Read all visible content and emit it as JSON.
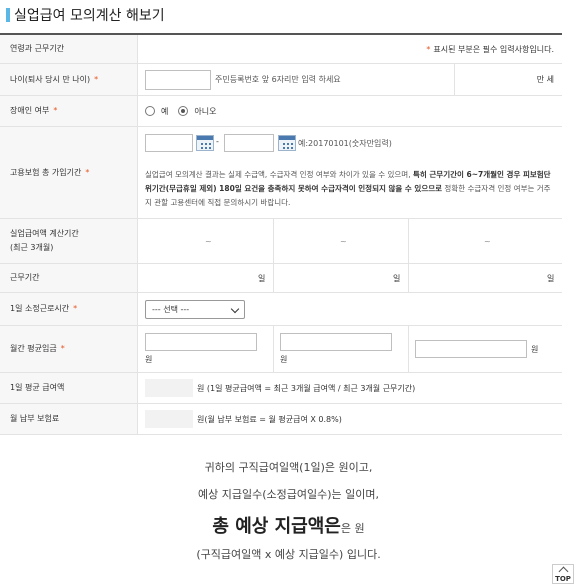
{
  "title": "실업급여 모의계산 해보기",
  "header": {
    "label": "연령과 근무기간",
    "required_note": "표시된 부분은 필수 입력사항입니다."
  },
  "age": {
    "label": "나이(퇴사 당시 만 나이)",
    "hint": "주민등록번호 앞 6자리만 입력 하세요",
    "suffix": "만 세",
    "value": ""
  },
  "disabled": {
    "label": "장애인 여부",
    "opt_yes": "예",
    "opt_no": "아니오",
    "selected": "아니오"
  },
  "insurance": {
    "label": "고용보험 총 가입기간",
    "sep": "-",
    "example": "예:20170101(숫자만입력)",
    "notice_1": "실업급여 모의계산 결과는 실제 수급액, 수급자격 인정 여부와 차이가 있을 수 있으며, ",
    "notice_bold": "특히 근무기간이 6~7개월인 경우 피보험단위기간(무급휴일 제외) 180일 요건을 충족하지 못하여 수급자격이 인정되지 않을 수 있으므로",
    "notice_2": " 정확한 수급자격 인정 여부는 거주지 관할 고용센터에 직접 문의하시기 바랍니다."
  },
  "calc_period": {
    "label_line1": "실업급여액 계산기간",
    "label_line2": "(최근 3개월)",
    "cols": [
      "~",
      "~",
      "~"
    ]
  },
  "work_days": {
    "label": "근무기간",
    "unit": "일"
  },
  "hours": {
    "label": "1일 소정근로시간",
    "selected": "--- 선택 ---"
  },
  "wage": {
    "label": "월간 평균임금",
    "unit": "원"
  },
  "daily_avg": {
    "label": "1일 평균 급여액",
    "note": "원 (1일 평균급여액 = 최근 3개월 급여액 / 최근 3개월 근무기간)"
  },
  "premium": {
    "label": "월 납부 보험료",
    "note": "원(월 납부 보험료 = 월 평균급여 X 0.8%)"
  },
  "summary": {
    "line1": "귀하의 구직급여일액(1일)은 원이고,",
    "line2": "예상 지급일수(소정급여일수)는 일이며,",
    "line3_big": "총 예상 지급액은",
    "line3_rest": "은 원",
    "line4": "(구직급여일액 x 예상 지급일수) 입니다."
  },
  "top_button": "TOP",
  "colors": {
    "accent": "#5bb7e6",
    "required": "#e8541f"
  }
}
